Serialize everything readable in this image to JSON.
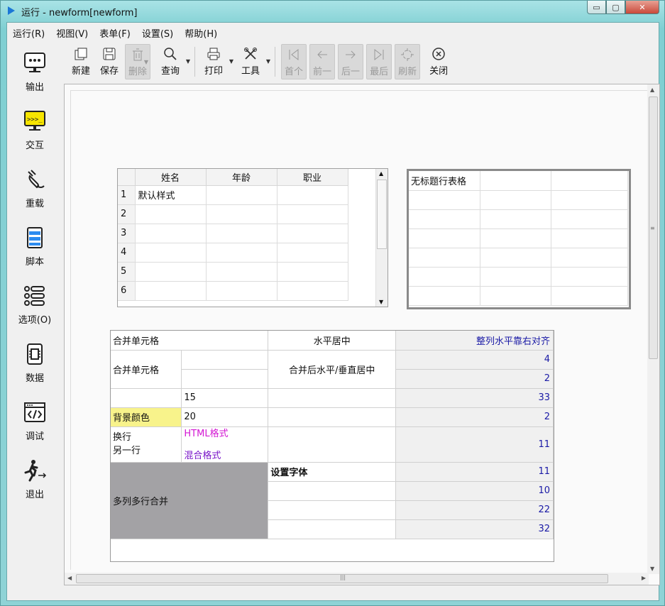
{
  "window": {
    "title": "运行 - newform[newform]",
    "controls": {
      "minimize": "▭",
      "maximize": "▢",
      "close": "✕"
    }
  },
  "menubar": [
    "运行(R)",
    "视图(V)",
    "表单(F)",
    "设置(S)",
    "帮助(H)"
  ],
  "sidebar": [
    {
      "label": "输出",
      "icon": "monitor-icon"
    },
    {
      "label": "交互",
      "icon": "terminal-icon"
    },
    {
      "label": "重载",
      "icon": "plug-icon"
    },
    {
      "label": "脚本",
      "icon": "script-icon"
    },
    {
      "label": "选项(O)",
      "icon": "list-icon"
    },
    {
      "label": "数据",
      "icon": "chip-icon"
    },
    {
      "label": "调试",
      "icon": "code-icon"
    },
    {
      "label": "退出",
      "icon": "exit-icon"
    }
  ],
  "toolbar": {
    "new": "新建",
    "save": "保存",
    "delete": "删除",
    "query": "查询",
    "print": "打印",
    "tools": "工具",
    "first": "首个",
    "prev": "前一",
    "next": "后一",
    "last": "最后",
    "refresh": "刷新",
    "close": "关闭"
  },
  "table1": {
    "headers": [
      "姓名",
      "年龄",
      "职业"
    ],
    "rows": [
      {
        "num": "1",
        "name": "默认样式"
      },
      {
        "num": "2",
        "name": ""
      },
      {
        "num": "3",
        "name": ""
      },
      {
        "num": "4",
        "name": ""
      },
      {
        "num": "5",
        "name": ""
      },
      {
        "num": "6",
        "name": ""
      }
    ]
  },
  "table2": {
    "first_cell": "无标题行表格"
  },
  "table3": {
    "merged_a": "合并单元格",
    "center_h": "水平居中",
    "right_align_col": "整列水平靠右对齐",
    "merged_b": "合并单元格",
    "merged_center": "合并后水平/垂直居中",
    "val_15": "15",
    "bg_color": "背景颜色",
    "val_20": "20",
    "wrap_line1": "换行",
    "wrap_line2": "另一行",
    "html_fmt": "HTML格式",
    "mixed_fmt": "混合格式",
    "set_font": "设置字体",
    "multi_merge": "多列多行合并",
    "numbers": [
      "4",
      "2",
      "33",
      "2",
      "11",
      "11",
      "10",
      "22",
      "32"
    ]
  }
}
